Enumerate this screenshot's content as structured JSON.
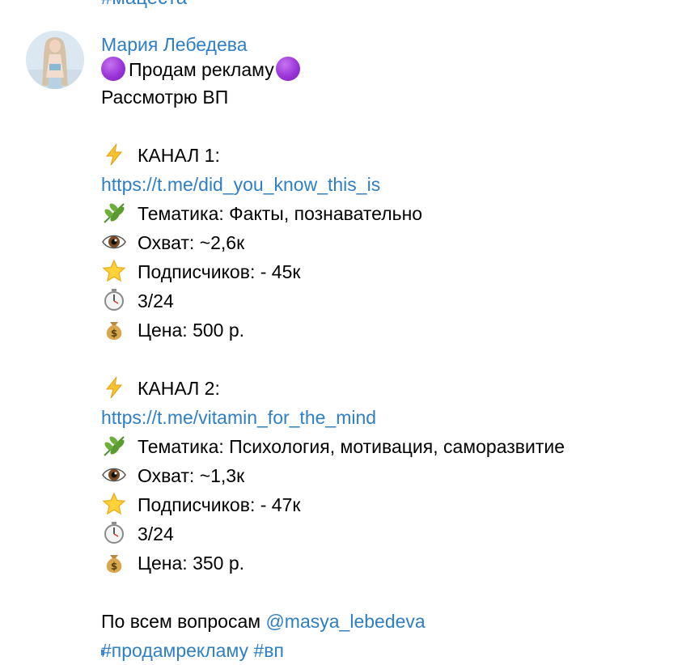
{
  "previous_message": {
    "hashtag": "#мацеста"
  },
  "message": {
    "author": "Мария Лебедева",
    "title": "Продам рекламу",
    "subtitle": "Рассмотрю ВП",
    "channels": [
      {
        "heading": "КАНАЛ 1:",
        "link": "https://t.me/did_you_know_this_is",
        "topic": "Тематика: Факты, познавательно",
        "reach": "Охват: ~2,6к",
        "subscribers": "Подписчиков: - 45к",
        "time": "3/24",
        "price": "Цена: 500 р."
      },
      {
        "heading": "КАНАЛ 2:",
        "link": "https://t.me/vitamin_for_the_mind",
        "topic": "Тематика: Психология, мотивация, саморазвитие",
        "reach": "Охват: ~1,3к",
        "subscribers": "Подписчиков: - 47к",
        "time": "3/24",
        "price": "Цена: 350 р."
      }
    ],
    "contact_text": "По всем вопросам",
    "contact_mention": "@masya_lebedeva",
    "hashtag_1": "#продамрекламу",
    "hashtag_2": "#вп"
  },
  "icons": {
    "title_decoration": "purple-circle-icon",
    "heading": "lightning-icon",
    "topic": "herb-icon",
    "reach": "eye-icon",
    "subscribers": "star-icon",
    "time": "stopwatch-icon",
    "price": "money-bag-icon"
  },
  "colors": {
    "link": "#2f7fc4",
    "author": "#2f7fc4",
    "text": "#000000",
    "purple_circle": "#9a35d8"
  }
}
